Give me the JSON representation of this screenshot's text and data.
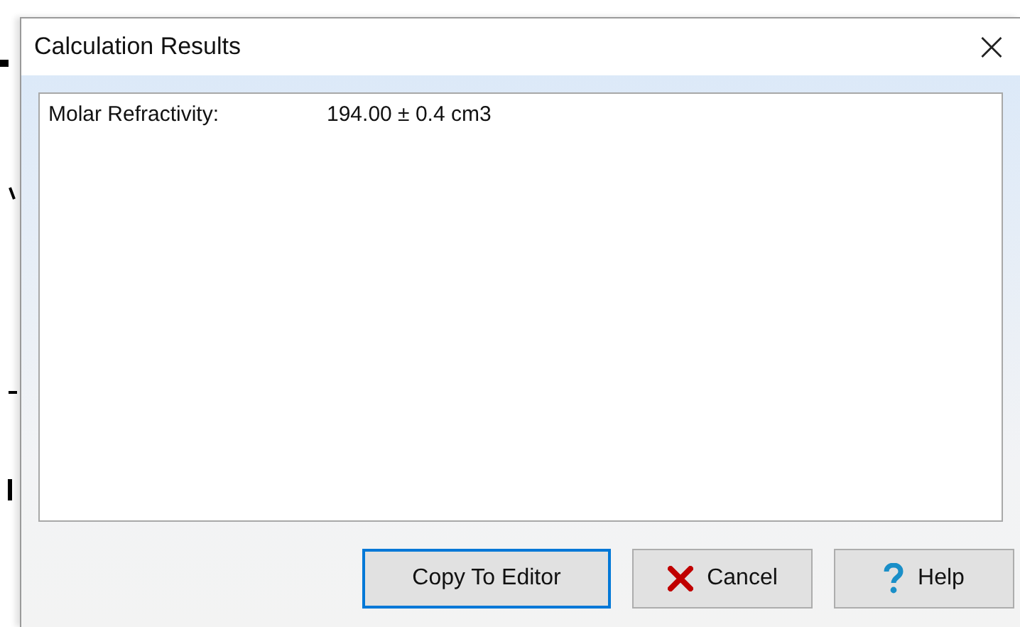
{
  "window": {
    "title": "Calculation Results",
    "close_glyph": "×"
  },
  "results": [
    {
      "label": "Molar Refractivity:",
      "value": "194.00 ± 0.4 cm3"
    }
  ],
  "buttons": [
    {
      "kind": "plain",
      "label": "Copy To Editor",
      "focused": true
    },
    {
      "kind": "cancel",
      "label": "Cancel",
      "focused": false
    },
    {
      "kind": "help",
      "label": "Help",
      "focused": false
    }
  ]
}
